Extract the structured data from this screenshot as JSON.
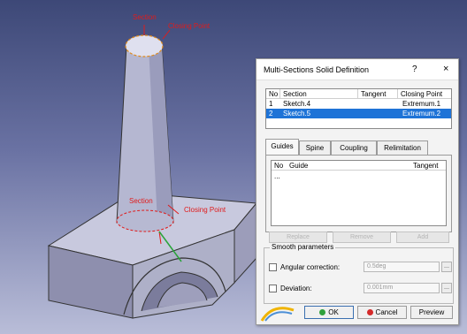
{
  "viewport": {
    "labels": {
      "section_top": "Section",
      "closing_point_top": "Closing Point",
      "section_bottom": "Section",
      "closing_point_bottom": "Closing Point"
    }
  },
  "dialog": {
    "title": "Multi-Sections Solid Definition",
    "help": "?",
    "close": "×",
    "section_table": {
      "headers": {
        "no": "No",
        "section": "Section",
        "tangent": "Tangent",
        "closing_point": "Closing Point"
      },
      "rows": [
        {
          "no": "1",
          "section": "Sketch.4",
          "tangent": "",
          "closing_point": "Extremum.1"
        },
        {
          "no": "2",
          "section": "Sketch.5",
          "tangent": "",
          "closing_point": "Extremum.2"
        }
      ]
    },
    "tabs": [
      {
        "label": "Guides"
      },
      {
        "label": "Spine"
      },
      {
        "label": "Coupling"
      },
      {
        "label": "Relimitation"
      }
    ],
    "guide_table": {
      "headers": {
        "no": "No",
        "guide": "Guide",
        "tangent": "Tangent"
      },
      "placeholder": "..."
    },
    "action_buttons": {
      "replace": "Replace",
      "remove": "Remove",
      "add": "Add"
    },
    "smooth": {
      "title": "Smooth parameters",
      "angular_label": "Angular correction:",
      "angular_value": "0.5deg",
      "deviation_label": "Deviation:",
      "deviation_value": "0.001mm"
    },
    "buttons": {
      "ok": "OK",
      "cancel": "Cancel",
      "preview": "Preview"
    }
  },
  "colors": {
    "accent_selection": "#1e73d7",
    "annotation_red": "#e01b1b"
  }
}
